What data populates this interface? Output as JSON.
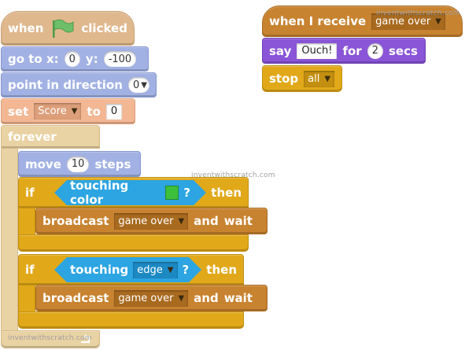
{
  "left_script": {
    "hat": {
      "prefix": "when",
      "suffix": "clicked",
      "icon": "green-flag-icon"
    },
    "goto": {
      "label": "go to x:",
      "x_value": "0",
      "y_label": "y:",
      "y_value": "-100"
    },
    "point": {
      "label": "point in direction",
      "value": "0"
    },
    "set": {
      "label": "set",
      "variable": "Score",
      "to_label": "to",
      "value": "0"
    },
    "forever": {
      "label": "forever",
      "end_icon": "loop-arrow-icon"
    },
    "move": {
      "label": "move",
      "value": "10",
      "suffix": "steps"
    },
    "if1": {
      "if_label": "if",
      "then_label": "then",
      "condition": {
        "label": "touching color",
        "color": "#3cc03c",
        "q": "?"
      },
      "broadcast": {
        "label": "broadcast",
        "message": "game over",
        "suffix": "and",
        "wait": "wait"
      }
    },
    "if2": {
      "if_label": "if",
      "then_label": "then",
      "condition": {
        "label": "touching",
        "target": "edge",
        "q": "?"
      },
      "broadcast": {
        "label": "broadcast",
        "message": "game over",
        "suffix": "and",
        "wait": "wait"
      }
    }
  },
  "right_script": {
    "hat": {
      "label": "when I receive",
      "message": "game over"
    },
    "say": {
      "label": "say",
      "text": "Ouch!",
      "for_label": "for",
      "seconds": "2",
      "secs_label": "secs"
    },
    "stop": {
      "label": "stop",
      "option": "all"
    }
  },
  "watermarks": {
    "wm1": "inventwithscratch.com",
    "wm2": "inventwithscratch.com",
    "wm3": "inventwithscratch.com"
  },
  "colors": {
    "events": "#c88330",
    "looks": "#8a55d7",
    "motion": "#4a6cd4",
    "control": "#e1a91a",
    "sensing": "#2ca5e2",
    "data": "#f3b794"
  }
}
